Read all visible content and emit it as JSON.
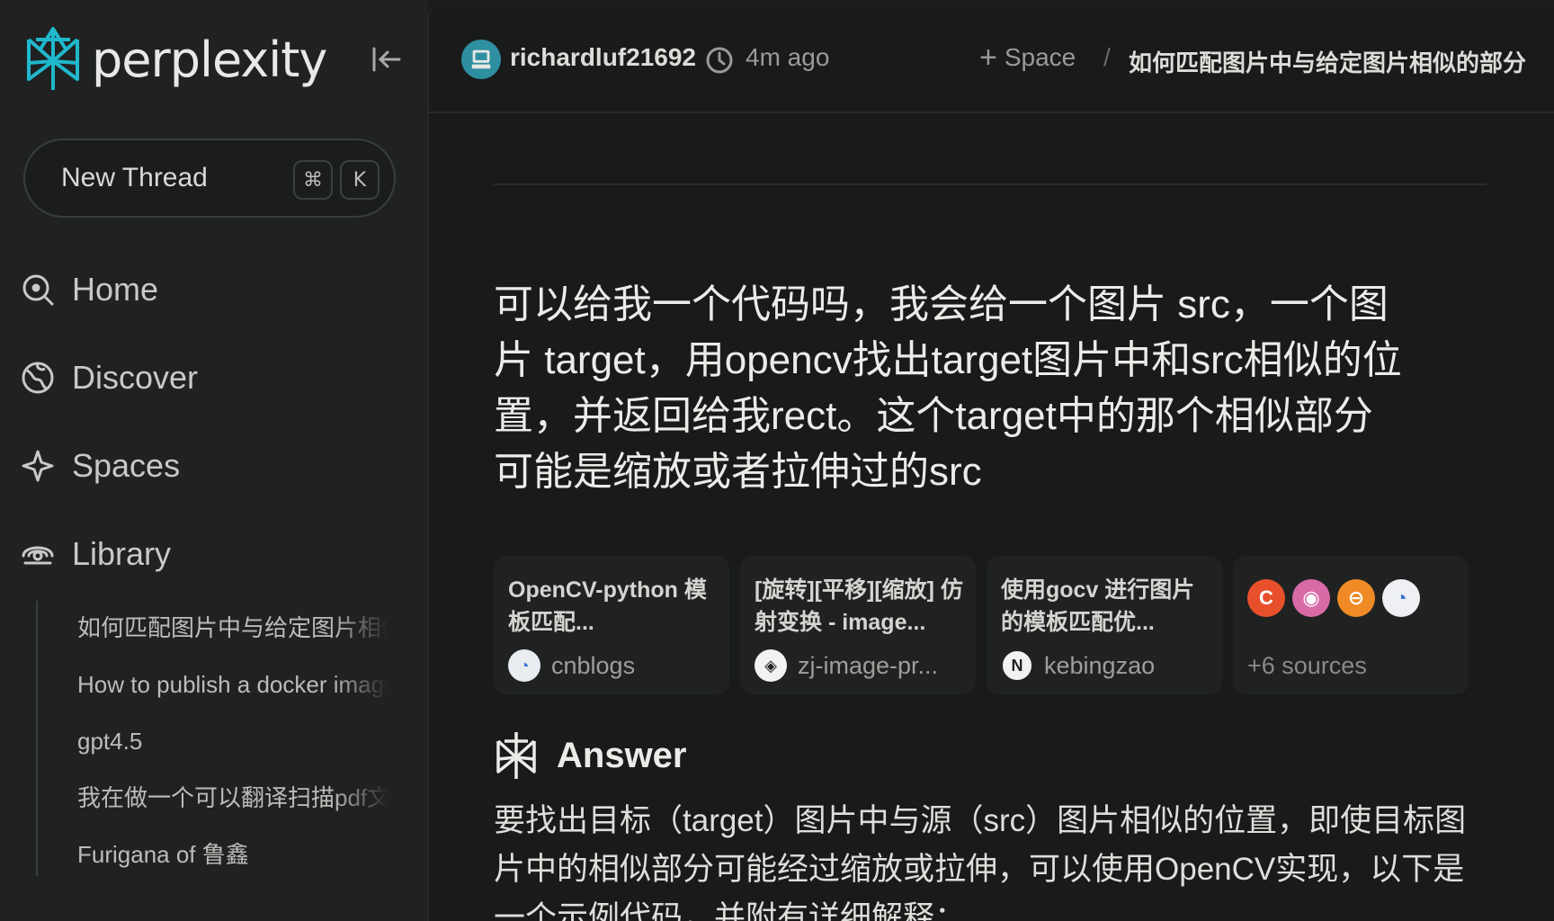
{
  "brand": {
    "name": "perplexity",
    "accent": "#20b8cd"
  },
  "sidebar": {
    "new_thread_label": "New Thread",
    "shortcut_keys": [
      "⌘",
      "K"
    ],
    "nav": [
      {
        "label": "Home",
        "icon": "search-icon"
      },
      {
        "label": "Discover",
        "icon": "globe-icon"
      },
      {
        "label": "Spaces",
        "icon": "sparkle-icon"
      },
      {
        "label": "Library",
        "icon": "library-icon"
      }
    ],
    "library_items": [
      "如何匹配图片中与给定图片相似的部分",
      "How to publish a docker image",
      "gpt4.5",
      "我在做一个可以翻译扫描pdf文件",
      "Furigana of 鲁鑫"
    ]
  },
  "header": {
    "username": "richardluf21692",
    "time_ago": "4m ago",
    "space_label": "Space",
    "separator": "/",
    "thread_title": "如何匹配图片中与给定图片相似的部分"
  },
  "thread": {
    "question": "可以给我一个代码吗，我会给一个图片 src，一个图片 target，用opencv找出target图片中和src相似的位置，并返回给我rect。这个target中的那个相似部分可能是缩放或者拉伸过的src",
    "sources": [
      {
        "title": "OpenCV-python 模板匹配...",
        "site": "cnblogs",
        "icon": "cnblogs-icon"
      },
      {
        "title": "[旋转][平移][缩放] 仿射变换 - image...",
        "site": "zj-image-pr...",
        "icon": "zj-image-icon"
      },
      {
        "title": "使用gocv 进行图片的模板匹配优...",
        "site": "kebingzao",
        "icon": "kebingzao-icon"
      }
    ],
    "more_sources_label": "+6 sources",
    "answer_label": "Answer",
    "answer_text": "要找出目标（target）图片中与源（src）图片相似的位置，即使目标图片中的相似部分可能经过缩放或拉伸，可以使用OpenCV实现，以下是一个示例代码，并附有详细解释："
  }
}
